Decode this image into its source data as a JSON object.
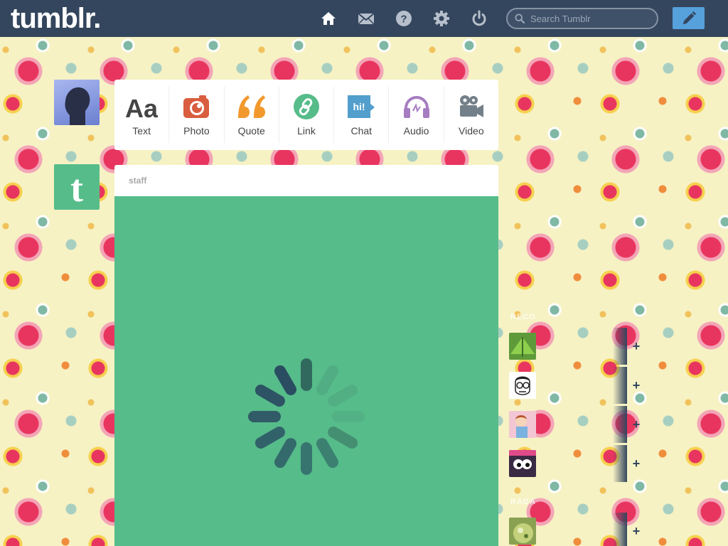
{
  "header": {
    "logo": "tumblr.",
    "search": {
      "placeholder": "Search Tumblr",
      "value": ""
    },
    "nav": [
      {
        "icon": "home-icon"
      },
      {
        "icon": "mail-icon"
      },
      {
        "icon": "help-icon"
      },
      {
        "icon": "gear-icon"
      },
      {
        "icon": "power-icon"
      }
    ],
    "compose_icon": "pencil-icon"
  },
  "post_types": [
    {
      "label": "Text",
      "color": "#444444"
    },
    {
      "label": "Photo",
      "color": "#d95e40"
    },
    {
      "label": "Quote",
      "color": "#f2992e"
    },
    {
      "label": "Link",
      "color": "#56bc8a"
    },
    {
      "label": "Chat",
      "color": "#529ecc"
    },
    {
      "label": "Audio",
      "color": "#a77dc2"
    },
    {
      "label": "Video",
      "color": "#748089"
    }
  ],
  "post": {
    "author": "staff",
    "body_color": "#56bc8a"
  },
  "sidebar": {
    "labels": [
      "RECO",
      "RADA"
    ],
    "recommended": [
      {
        "avatar": "leaf-avatar",
        "color": "#5f9a3a"
      },
      {
        "avatar": "glasses-face-avatar",
        "color": "#ffffff"
      },
      {
        "avatar": "cartoon-boy-avatar",
        "color": "#f3c6d3"
      },
      {
        "avatar": "googly-eyes-avatar",
        "color": "#3a2a44"
      }
    ],
    "radar": [
      {
        "avatar": "food-avatar",
        "color": "#8aa152"
      }
    ]
  },
  "colors": {
    "header_bg": "#34465d",
    "compose_bg": "#56a0dc",
    "staff_green": "#56bc8a"
  }
}
